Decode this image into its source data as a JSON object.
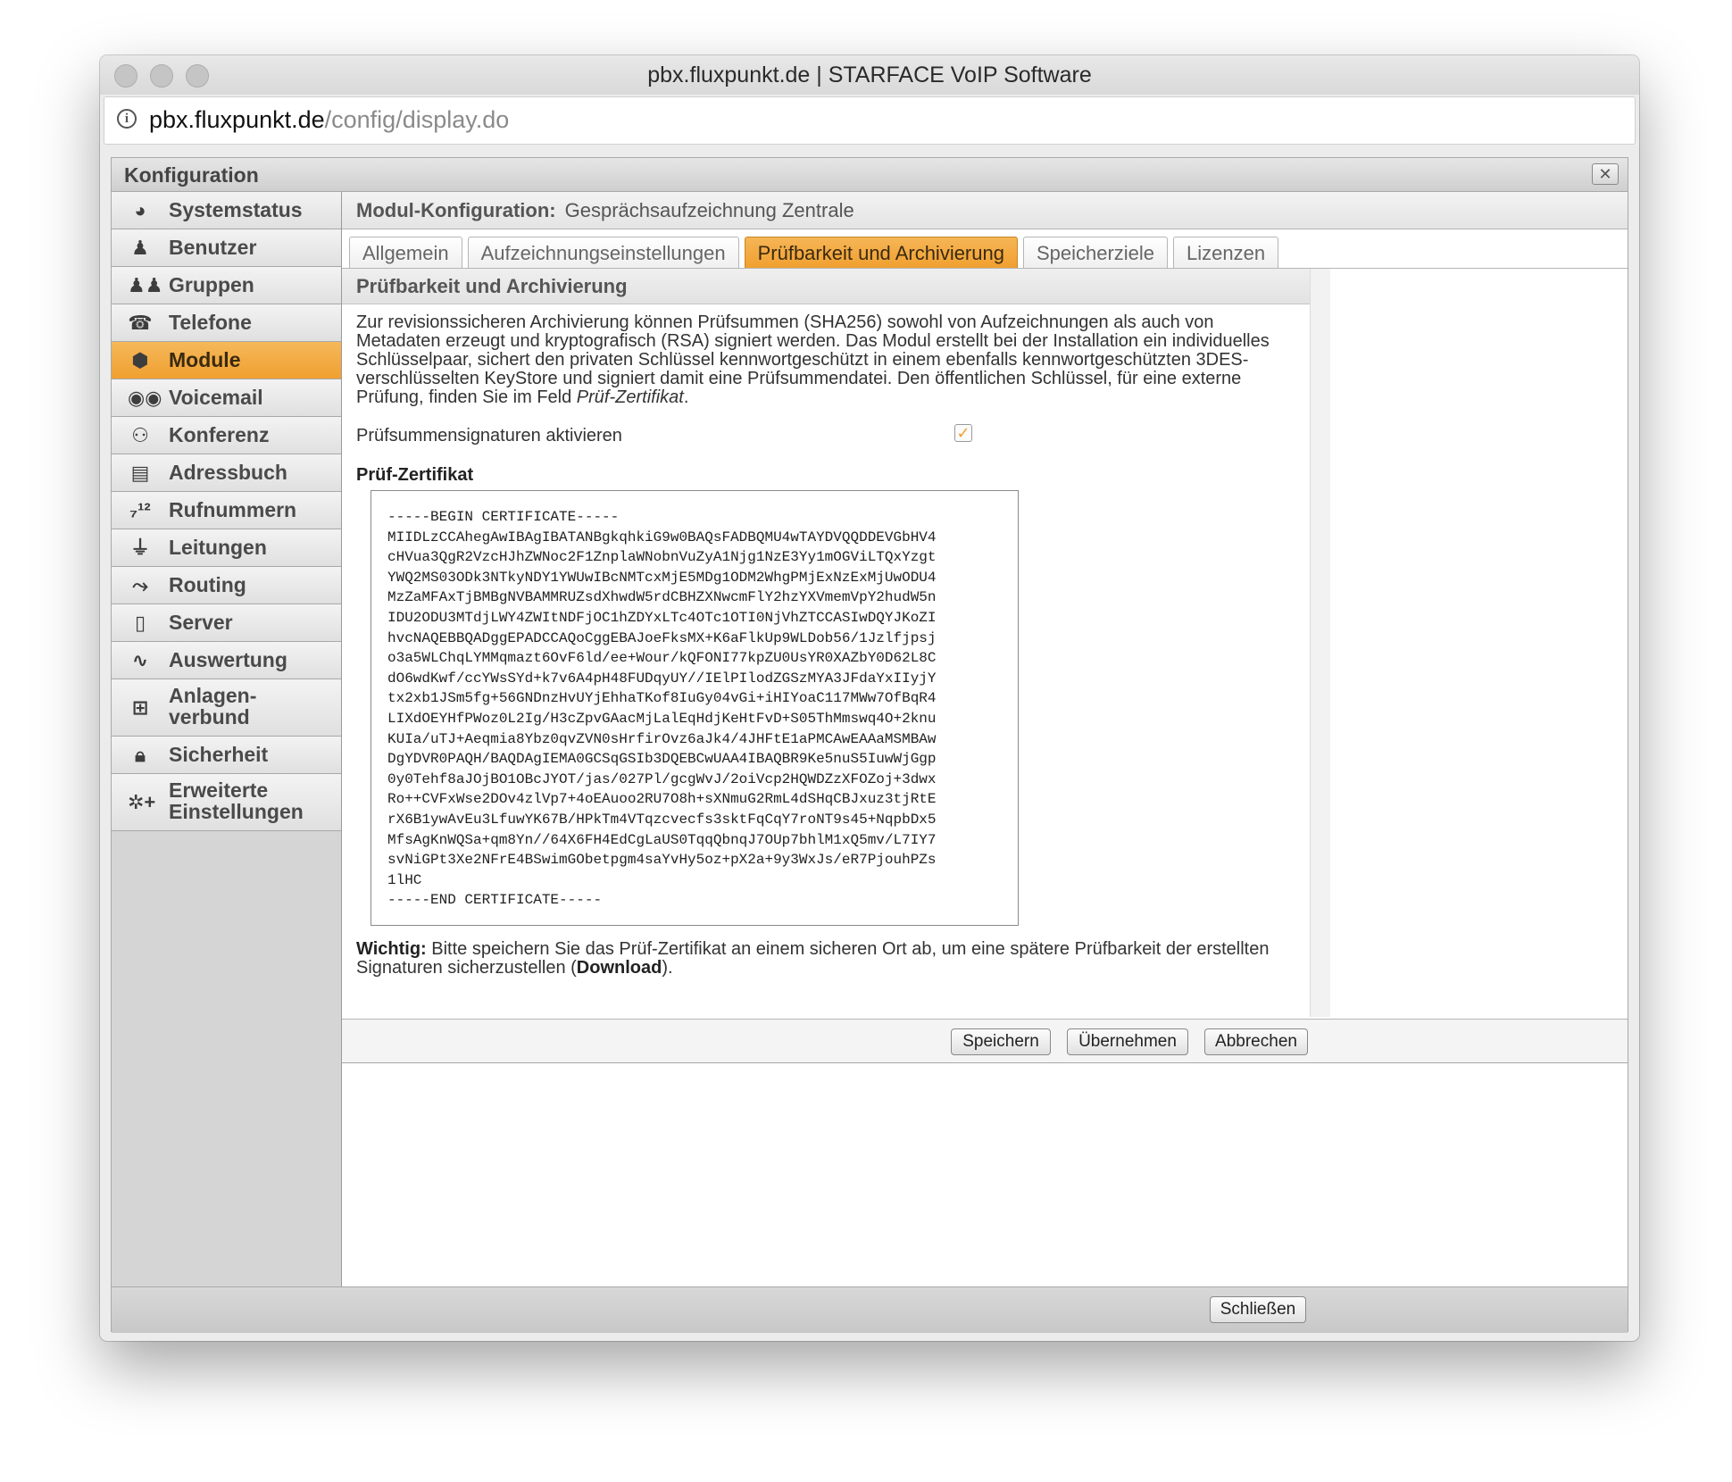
{
  "browser": {
    "title": "pbx.fluxpunkt.de | STARFACE VoIP Software",
    "url_domain": "pbx.fluxpunkt.de",
    "url_path": "/config/display.do"
  },
  "dialog": {
    "title": "Konfiguration",
    "close_glyph": "✕"
  },
  "sidebar": {
    "items": [
      {
        "label": "Systemstatus",
        "icon": "status-icon"
      },
      {
        "label": "Benutzer",
        "icon": "user-icon"
      },
      {
        "label": "Gruppen",
        "icon": "group-icon"
      },
      {
        "label": "Telefone",
        "icon": "phone-icon"
      },
      {
        "label": "Module",
        "icon": "module-icon",
        "active": true
      },
      {
        "label": "Voicemail",
        "icon": "voicemail-icon"
      },
      {
        "label": "Konferenz",
        "icon": "conference-icon"
      },
      {
        "label": "Adressbuch",
        "icon": "addressbook-icon"
      },
      {
        "label": "Rufnummern",
        "icon": "numbers-icon"
      },
      {
        "label": "Leitungen",
        "icon": "lines-icon"
      },
      {
        "label": "Routing",
        "icon": "routing-icon"
      },
      {
        "label": "Server",
        "icon": "server-icon"
      },
      {
        "label": "Auswertung",
        "icon": "chart-icon"
      },
      {
        "label": "Anlagen-verbund",
        "label_line1": "Anlagen-",
        "label_line2": "verbund",
        "icon": "network-icon"
      },
      {
        "label": "Sicherheit",
        "icon": "lock-icon"
      },
      {
        "label": "Erweiterte Einstellungen",
        "label_line1": "Erweiterte",
        "label_line2": "Einstellungen",
        "icon": "gears-icon"
      }
    ]
  },
  "module": {
    "heading_label": "Modul-Konfiguration:",
    "heading_value": "Gesprächsaufzeichnung Zentrale"
  },
  "tabs": [
    {
      "label": "Allgemein"
    },
    {
      "label": "Aufzeichnungseinstellungen"
    },
    {
      "label": "Prüfbarkeit und Archivierung",
      "active": true
    },
    {
      "label": "Speicherziele"
    },
    {
      "label": "Lizenzen"
    }
  ],
  "section": {
    "title": "Prüfbarkeit und Archivierung",
    "description_main": "Zur revisionssicheren Archivierung können Prüfsummen (SHA256) sowohl von Aufzeichnungen als auch von Metadaten erzeugt und kryptografisch (RSA) signiert werden. Das Modul erstellt bei der Installation ein individuelles Schlüsselpaar, sichert den privaten Schlüssel kennwortgeschützt in einem ebenfalls kennwortgeschützten 3DES-verschlüsselten KeyStore und signiert damit eine Prüfsummendatei. Den öffentlichen Schlüssel, für eine externe Prüfung, finden Sie im Feld ",
    "description_field": "Prüf-Zertifikat",
    "description_end": ".",
    "activate_label": "Prüfsummensignaturen aktivieren",
    "activate_checked": true,
    "checkbox_glyph": "✓",
    "cert_title": "Prüf-Zertifikat",
    "certificate": "-----BEGIN CERTIFICATE-----\nMIIDLzCCAhegAwIBAgIBATANBgkqhkiG9w0BAQsFADBQMU4wTAYDVQQDDEVGbHV4\ncHVua3QgR2VzcHJhZWNoc2F1ZnplaWNobnVuZyA1Njg1NzE3Yy1mOGViLTQxYzgt\nYWQ2MS03ODk3NTkyNDY1YWUwIBcNMTcxMjE5MDg1ODM2WhgPMjExNzExMjUwODU4\nMzZaMFAxTjBMBgNVBAMMRUZsdXhwdW5rdCBHZXNwcmFlY2hzYXVmemVpY2hudW5n\nIDU2ODU3MTdjLWY4ZWItNDFjOC1hZDYxLTc4OTc1OTI0NjVhZTCCASIwDQYJKoZI\nhvcNAQEBBQADggEPADCCAQoCggEBAJoeFksMX+K6aFlkUp9WLDob56/1Jzlfjpsj\no3a5WLChqLYMMqmazt6OvF6ld/ee+Wour/kQFONI77kpZU0UsYR0XAZbY0D62L8C\ndO6wdKwf/ccYWsSYd+k7v6A4pH48FUDqyUY//IElPIlodZGSzMYA3JFdaYxIIyjY\ntx2xb1JSm5fg+56GNDnzHvUYjEhhaTKof8IuGy04vGi+iHIYoaC117MWw7OfBqR4\nLIXdOEYHfPWoz0L2Ig/H3cZpvGAacMjLalEqHdjKeHtFvD+S05ThMmswq4O+2knu\nKUIa/uTJ+Aeqmia8Ybz0qvZVN0sHrfirOvz6aJk4/4JHFtE1aPMCAwEAAaMSMBAw\nDgYDVR0PAQH/BAQDAgIEMA0GCSqGSIb3DQEBCwUAA4IBAQBR9Ke5nuS5IuwWjGgp\n0y0Tehf8aJOjBO1OBcJYOT/jas/027Pl/gcgWvJ/2oiVcp2HQWDZzXFOZoj+3dwx\nRo++CVFxWse2DOv4zlVp7+4oEAuoo2RU7O8h+sXNmuG2RmL4dSHqCBJxuz3tjRtE\nrX6B1ywAvEu3LfuwYK67B/HPkTm4VTqzcvecfs3sktFqCqY7roNT9s45+NqpbDx5\nMfsAgKnWQSa+qm8Yn//64X6FH4EdCgLaUS0TqqQbnqJ7OUp7bhlM1xQ5mv/L7IY7\nsvNiGPt3Xe2NFrE4BSwimGObetpgm4saYvHy5oz+pX2a+9y3WxJs/eR7PjouhPZs\n1lHC\n-----END CERTIFICATE-----",
    "note_bold": "Wichtig:",
    "note_text": " Bitte speichern Sie das Prüf-Zertifikat an einem sicheren Ort ab, um eine spätere Prüfbarkeit der erstellten Signaturen sicherzustellen (",
    "note_link": "Download",
    "note_end": ")."
  },
  "buttons": {
    "save": "Speichern",
    "apply": "Übernehmen",
    "cancel": "Abbrechen",
    "close": "Schließen"
  },
  "colors": {
    "accent_orange": "#f0a030"
  }
}
